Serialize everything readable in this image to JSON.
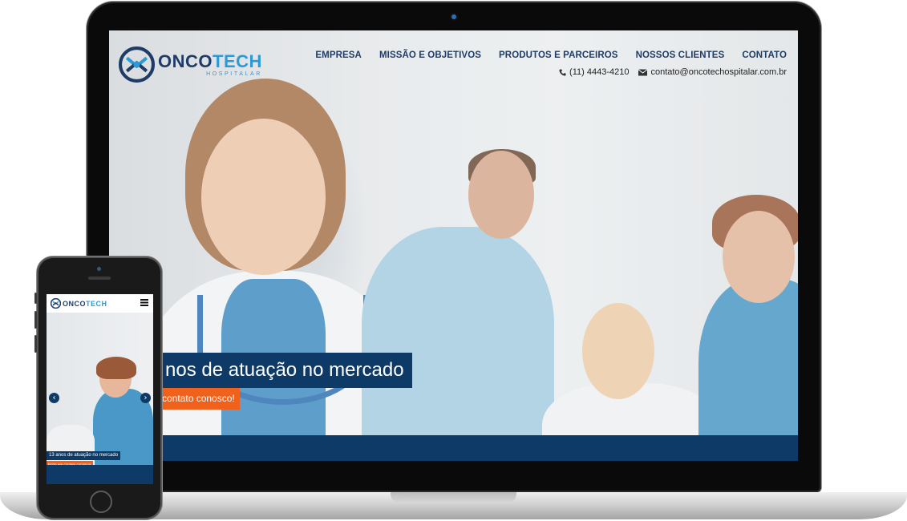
{
  "brand": {
    "name_part1": "ONCO",
    "name_part2": "TECH",
    "subtitle": "HOSPITALAR",
    "primary_color": "#1f3c66",
    "accent_color": "#2b9ad6",
    "cta_color": "#f0611b",
    "navy_band_color": "#0e3a68"
  },
  "nav": {
    "items": [
      "EMPRESA",
      "MISSÃO E OBJETIVOS",
      "PRODUTOS E PARCEIROS",
      "NOSSOS CLIENTES",
      "CONTATO"
    ]
  },
  "contact": {
    "phone": "(11) 4443-4210",
    "phone_icon": "phone-icon",
    "email": "contato@oncotechospitalar.com.br",
    "email_icon": "envelope-icon"
  },
  "hero": {
    "tagline": "nos de atuação no mercado",
    "cta": "contato conosco!"
  },
  "mobile": {
    "brand_name_part1": "ONCO",
    "brand_name_part2": "TECH",
    "menu_icon": "hamburger-menu-icon",
    "prev_icon": "chevron-left-icon",
    "next_icon": "chevron-right-icon",
    "prev_arrow": "‹",
    "next_arrow": "›",
    "tagline": "13 anos de atuação no mercado",
    "cta": "Entre em contato conosco!"
  }
}
